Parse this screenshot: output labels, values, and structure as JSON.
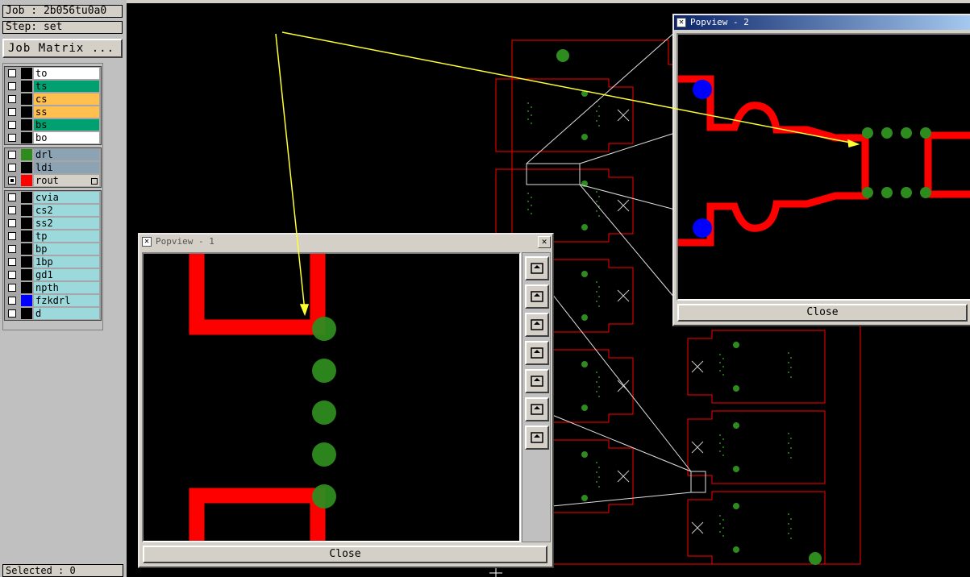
{
  "job_label": "Job : 2b056tu0a0",
  "step_label": "Step: set",
  "job_matrix_label": "Job Matrix ...",
  "status_text": "Selected : 0",
  "layer_groups": [
    [
      {
        "name": "to",
        "color": "#ffffff",
        "swatch": "",
        "checked": false
      },
      {
        "name": "ts",
        "color": "#00a070",
        "swatch": "",
        "checked": false
      },
      {
        "name": "cs",
        "color": "#ffc050",
        "swatch": "",
        "checked": false
      },
      {
        "name": "ss",
        "color": "#ffc050",
        "swatch": "",
        "checked": false
      },
      {
        "name": "bs",
        "color": "#00a070",
        "swatch": "",
        "checked": false
      },
      {
        "name": "bo",
        "color": "#ffffff",
        "swatch": "",
        "checked": false
      }
    ],
    [
      {
        "name": "drl",
        "color": "#8ca3b4",
        "swatch": "#2e8b1e",
        "checked": false
      },
      {
        "name": "ldi",
        "color": "#8ca3b4",
        "swatch": "",
        "checked": false
      },
      {
        "name": "rout",
        "color": "#d4d0c8",
        "swatch": "#ff0000",
        "checked": true
      }
    ],
    [
      {
        "name": "cvia",
        "color": "#9bd9dc",
        "swatch": "",
        "checked": false
      },
      {
        "name": "cs2",
        "color": "#9bd9dc",
        "swatch": "",
        "checked": false
      },
      {
        "name": "ss2",
        "color": "#9bd9dc",
        "swatch": "",
        "checked": false
      },
      {
        "name": "tp",
        "color": "#9bd9dc",
        "swatch": "",
        "checked": false
      },
      {
        "name": "bp",
        "color": "#9bd9dc",
        "swatch": "",
        "checked": false
      },
      {
        "name": "1bp",
        "color": "#9bd9dc",
        "swatch": "",
        "checked": false
      },
      {
        "name": "gd1",
        "color": "#9bd9dc",
        "swatch": "",
        "checked": false
      },
      {
        "name": "npth",
        "color": "#9bd9dc",
        "swatch": "",
        "checked": false
      },
      {
        "name": "fzkdrl",
        "color": "#9bd9dc",
        "swatch": "#0000ff",
        "checked": false
      },
      {
        "name": "d",
        "color": "#9bd9dc",
        "swatch": "",
        "checked": false
      }
    ]
  ],
  "popview1": {
    "title": "Popview - 1",
    "close_label": "Close",
    "tools": [
      "zoom-window-icon",
      "zoom-in-icon",
      "zoom-out-icon",
      "pan-left-icon",
      "pan-right-icon",
      "fit-icon",
      "pan-center-icon"
    ]
  },
  "popview2": {
    "title": "Popview - 2",
    "close_label": "Close"
  },
  "colors": {
    "rout": "#ff0000",
    "drill": "#2e8b1e",
    "fzkdrl": "#0000ff",
    "leader": "#ffff33",
    "canvas_bg": "#000000"
  }
}
